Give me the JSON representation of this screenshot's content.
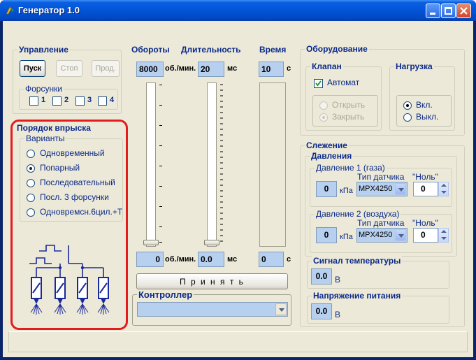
{
  "window": {
    "title": "Генератор 1.0"
  },
  "control": {
    "legend": "Управление",
    "start": "Пуск",
    "stop": "Стоп",
    "prod": "Прод.",
    "injectors_legend": "Форсунки",
    "injectors": [
      "1",
      "2",
      "3",
      "4"
    ]
  },
  "injection": {
    "legend": "Порядок впрыска",
    "variants_legend": "Варианты",
    "options": [
      "Одновременный",
      "Попарный",
      "Последовательный",
      "Посл. 3 форсунки",
      "Одновремсн.6цил.+Т"
    ],
    "selected": 1
  },
  "rpm": {
    "header": "Обороты",
    "value": "8000",
    "unit": "об./мин.",
    "actual": "0",
    "actual_unit": "об./мин."
  },
  "duration": {
    "header": "Длительность",
    "value": "20",
    "unit": "мс",
    "actual": "0.0",
    "actual_unit": "мс"
  },
  "time": {
    "header": "Время",
    "value": "10",
    "unit": "с",
    "actual": "0",
    "actual_unit": "с"
  },
  "apply_button": "П р и н я т ь",
  "controller": {
    "legend": "Контроллер",
    "value": ""
  },
  "equipment": {
    "legend": "Оборудование",
    "valve_legend": "Клапан",
    "auto": "Автомат",
    "open": "Открыть",
    "close": "Закрыть",
    "load_legend": "Нагрузка",
    "on": "Вкл.",
    "off": "Выкл."
  },
  "tracking": {
    "legend": "Слежение",
    "pressures_legend": "Давления",
    "p1": {
      "legend": "Давление 1 (газа)",
      "value": "0",
      "unit": "кПа",
      "sensor_label": "Тип датчика",
      "sensor": "MPX4250",
      "zero_label": "\"Ноль\"",
      "zero": "0"
    },
    "p2": {
      "legend": "Давление 2 (воздуха)",
      "value": "0",
      "unit": "кПа",
      "sensor_label": "Тип датчика",
      "sensor": "MPX4250",
      "zero_label": "\"Ноль\"",
      "zero": "0"
    },
    "temp": {
      "legend": "Сигнал температуры",
      "value": "0.0",
      "unit": "В"
    },
    "voltage": {
      "legend": "Напряжение питания",
      "value": "0.0",
      "unit": "В"
    }
  },
  "colors": {
    "title_bar": "#0054e3",
    "dialog": "#ece9d8",
    "header_text": "#0b2a8a",
    "field": "#b8d0f0",
    "highlight": "#e31c1c",
    "diagram": "#1a2a9a"
  }
}
